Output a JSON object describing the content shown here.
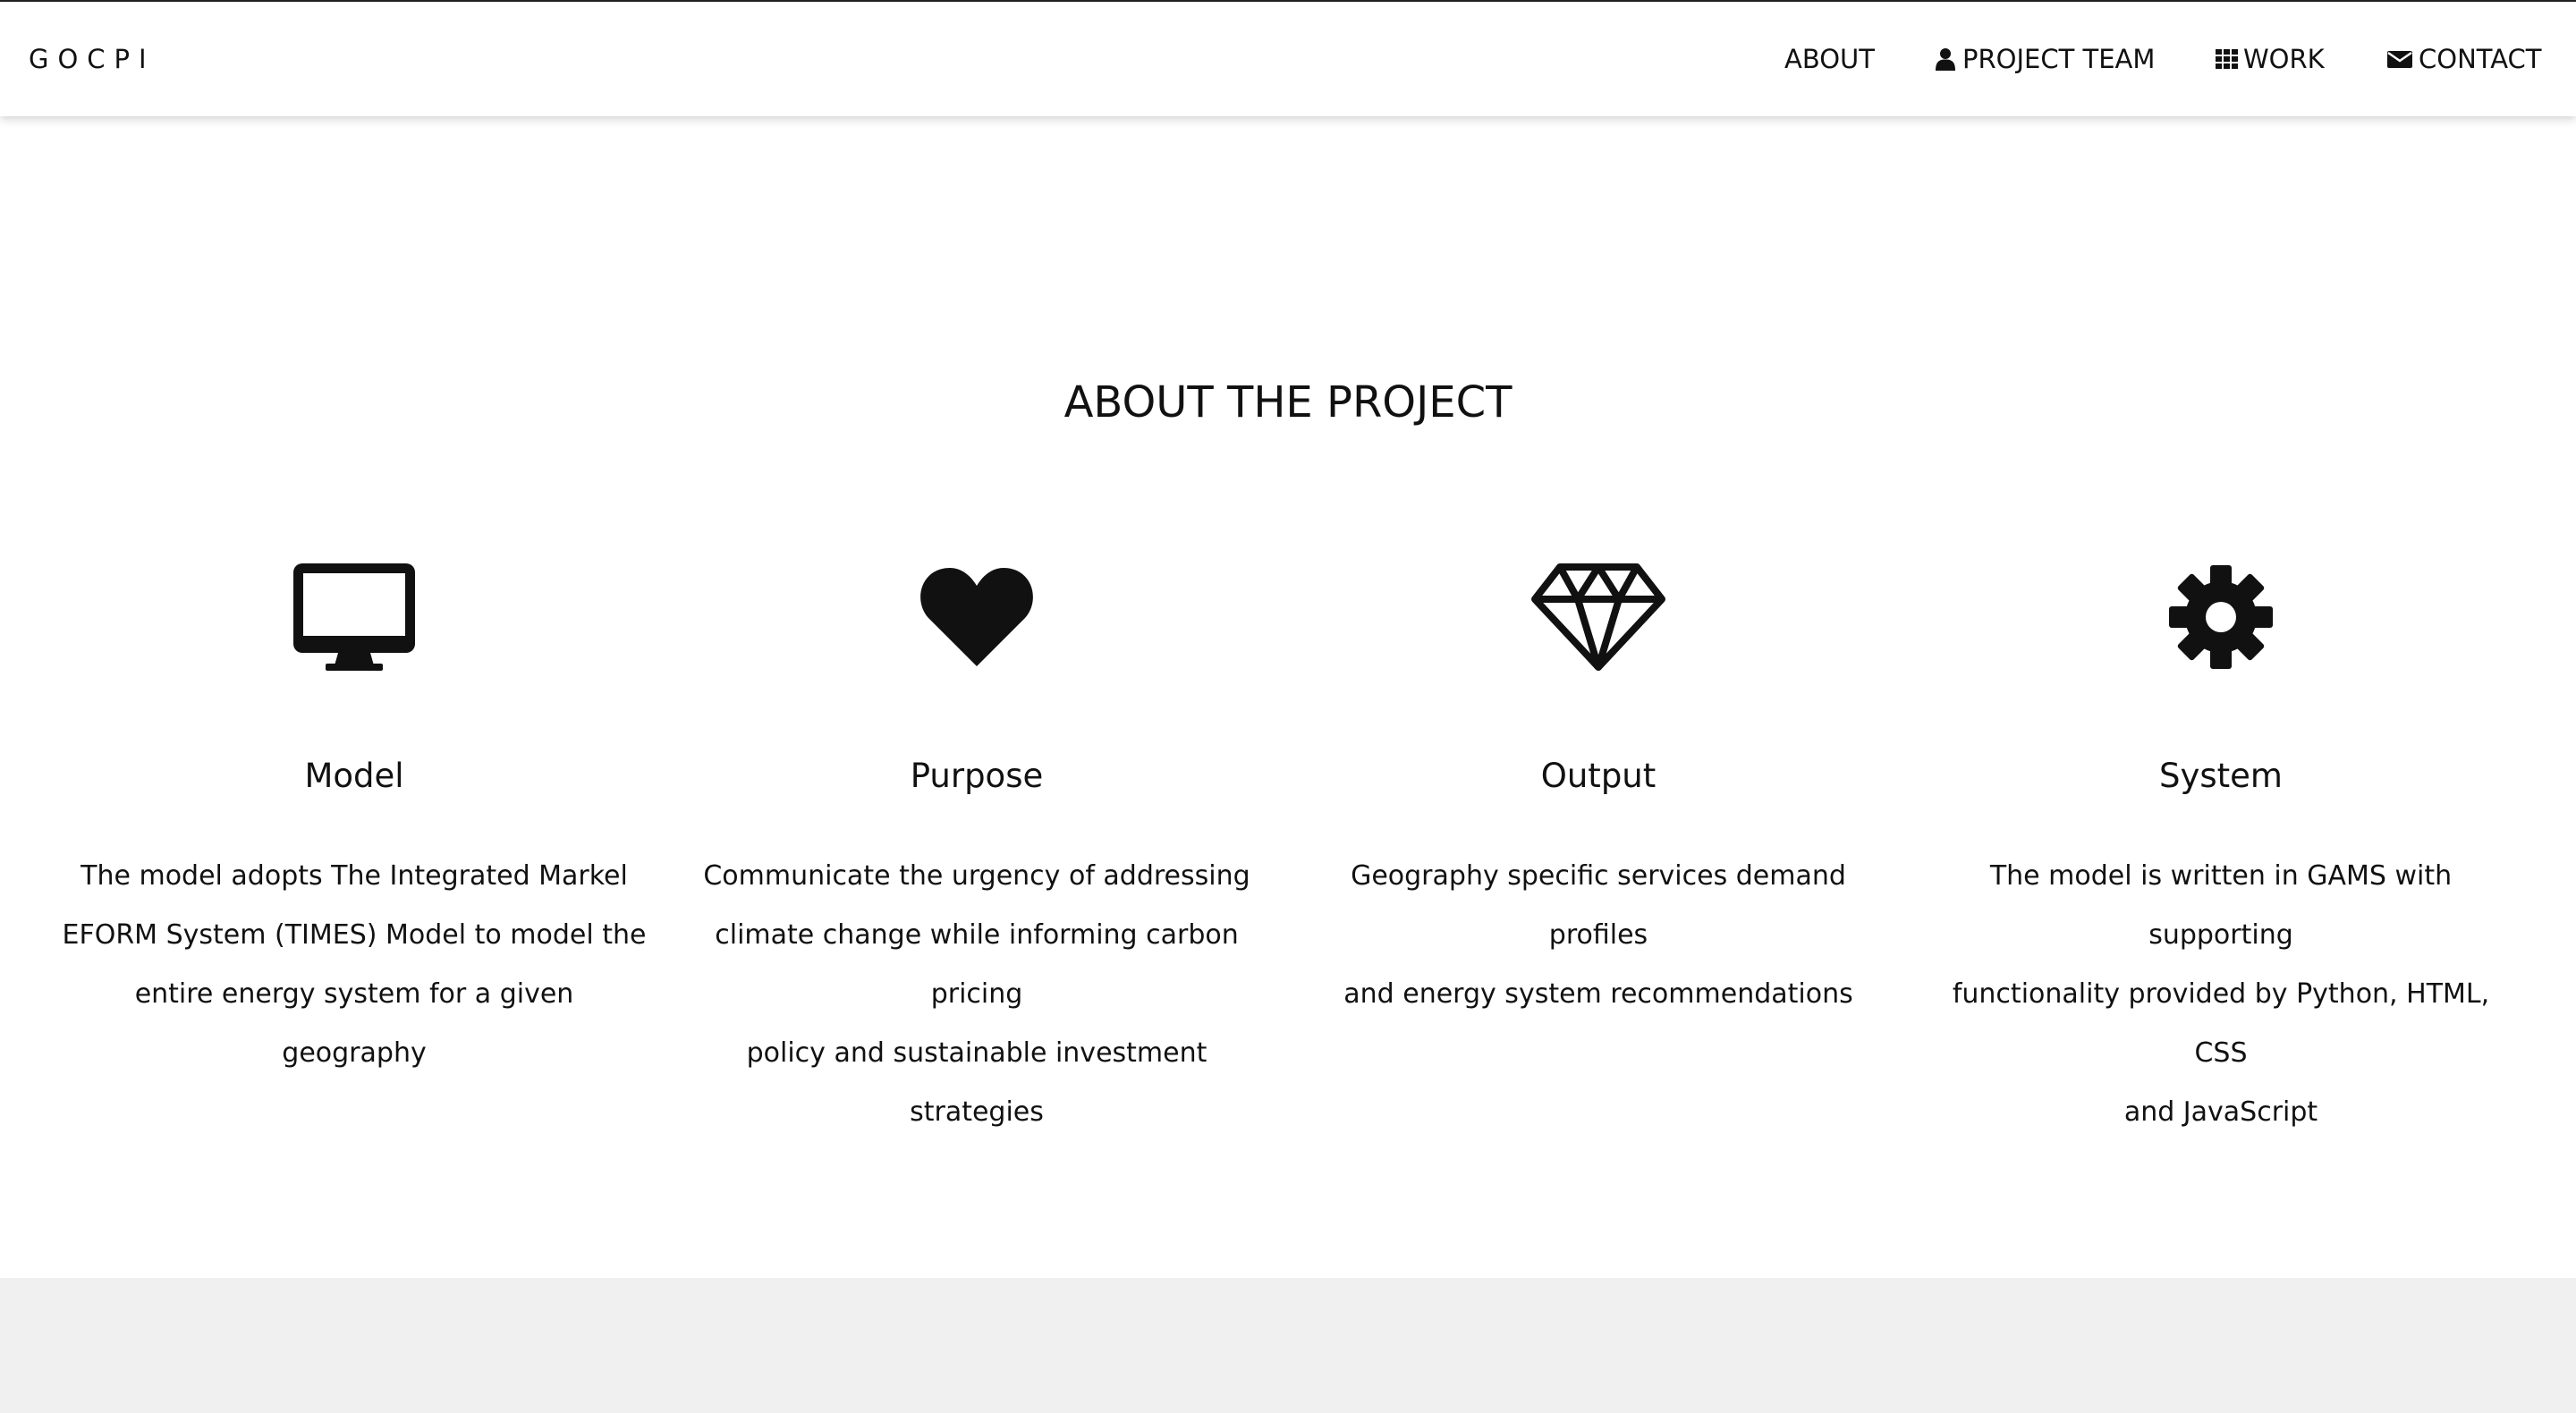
{
  "brand": "GOCPI",
  "nav": {
    "about": "ABOUT",
    "team": "PROJECT TEAM",
    "work": "WORK",
    "contact": "CONTACT",
    "icons": {
      "team": "user-icon",
      "work": "grid-icon",
      "contact": "envelope-icon"
    }
  },
  "section": {
    "title": "ABOUT THE PROJECT"
  },
  "features": [
    {
      "icon": "desktop-icon",
      "title": "Model",
      "lines": [
        "The model adopts The Integrated Markel",
        "EFORM System (TIMES) Model to model the",
        "entire energy system for a given geography"
      ]
    },
    {
      "icon": "heart-icon",
      "title": "Purpose",
      "lines": [
        "Communicate the urgency of addressing",
        "climate change while informing carbon pricing",
        "policy and sustainable investment strategies"
      ]
    },
    {
      "icon": "diamond-icon",
      "title": "Output",
      "lines": [
        "Geography specific services demand profiles",
        "and energy system recommendations"
      ]
    },
    {
      "icon": "gear-icon",
      "title": "System",
      "lines": [
        "The model is written in GAMS with supporting",
        "functionality provided by Python, HTML, CSS",
        "and JavaScript"
      ]
    }
  ],
  "colors": {
    "text": "#111111",
    "background": "#ffffff",
    "footer_band": "#f0f0f0"
  }
}
